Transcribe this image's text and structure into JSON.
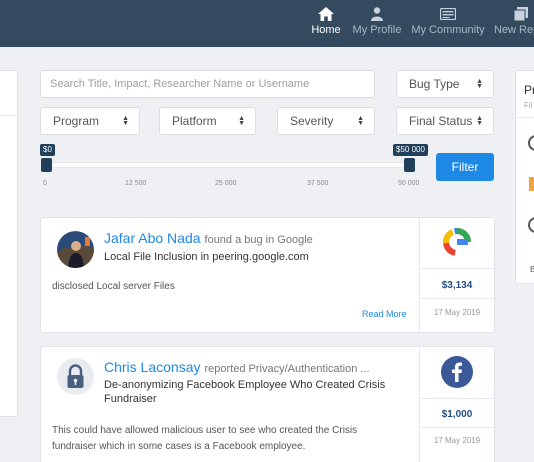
{
  "nav": {
    "items": [
      {
        "label": "Home",
        "icon": "home-icon",
        "active": true
      },
      {
        "label": "My Profile",
        "icon": "user-icon",
        "active": false
      },
      {
        "label": "My Community",
        "icon": "community-icon",
        "active": false
      },
      {
        "label": "New Rep",
        "icon": "new-report-icon",
        "active": false
      }
    ]
  },
  "right_panel": {
    "title": "Pr",
    "subtitle": "Fil",
    "footer": "B"
  },
  "filters": {
    "search_placeholder": "Search Title, Impact, Researcher Name or Username",
    "bug_type": "Bug Type",
    "program": "Program",
    "platform": "Platform",
    "severity": "Severity",
    "final_status": "Final Status",
    "filter_button": "Filter",
    "slider": {
      "min_label": "$0",
      "max_label": "$50 000",
      "ticks": [
        "0",
        "12 500",
        "25 000",
        "37 500",
        "50 000"
      ]
    }
  },
  "colors": {
    "nav_bg": "#344a5e",
    "accent": "#1e88e5",
    "amount": "#1f4f86",
    "slider_handle": "#1f3f5a"
  },
  "reports": [
    {
      "researcher": "Jafar Abo Nada",
      "action": "found a bug in Google",
      "title": "Local File Inclusion in peering.google.com",
      "description": "disclosed Local server Files",
      "read_more": "Read More",
      "amount": "$3,134",
      "date": "17 May 2019",
      "program_logo": "google-logo"
    },
    {
      "researcher": "Chris Laconsay",
      "action": "reported Privacy/Authentication ...",
      "title": "De-anonymizing Facebook Employee Who Created Crisis Fundraiser",
      "description": "This could have allowed malicious user to see who created the Crisis fundraiser which in some cases is a Facebook employee.",
      "amount": "$1,000",
      "date": "17 May 2019",
      "program_logo": "facebook-logo"
    }
  ]
}
